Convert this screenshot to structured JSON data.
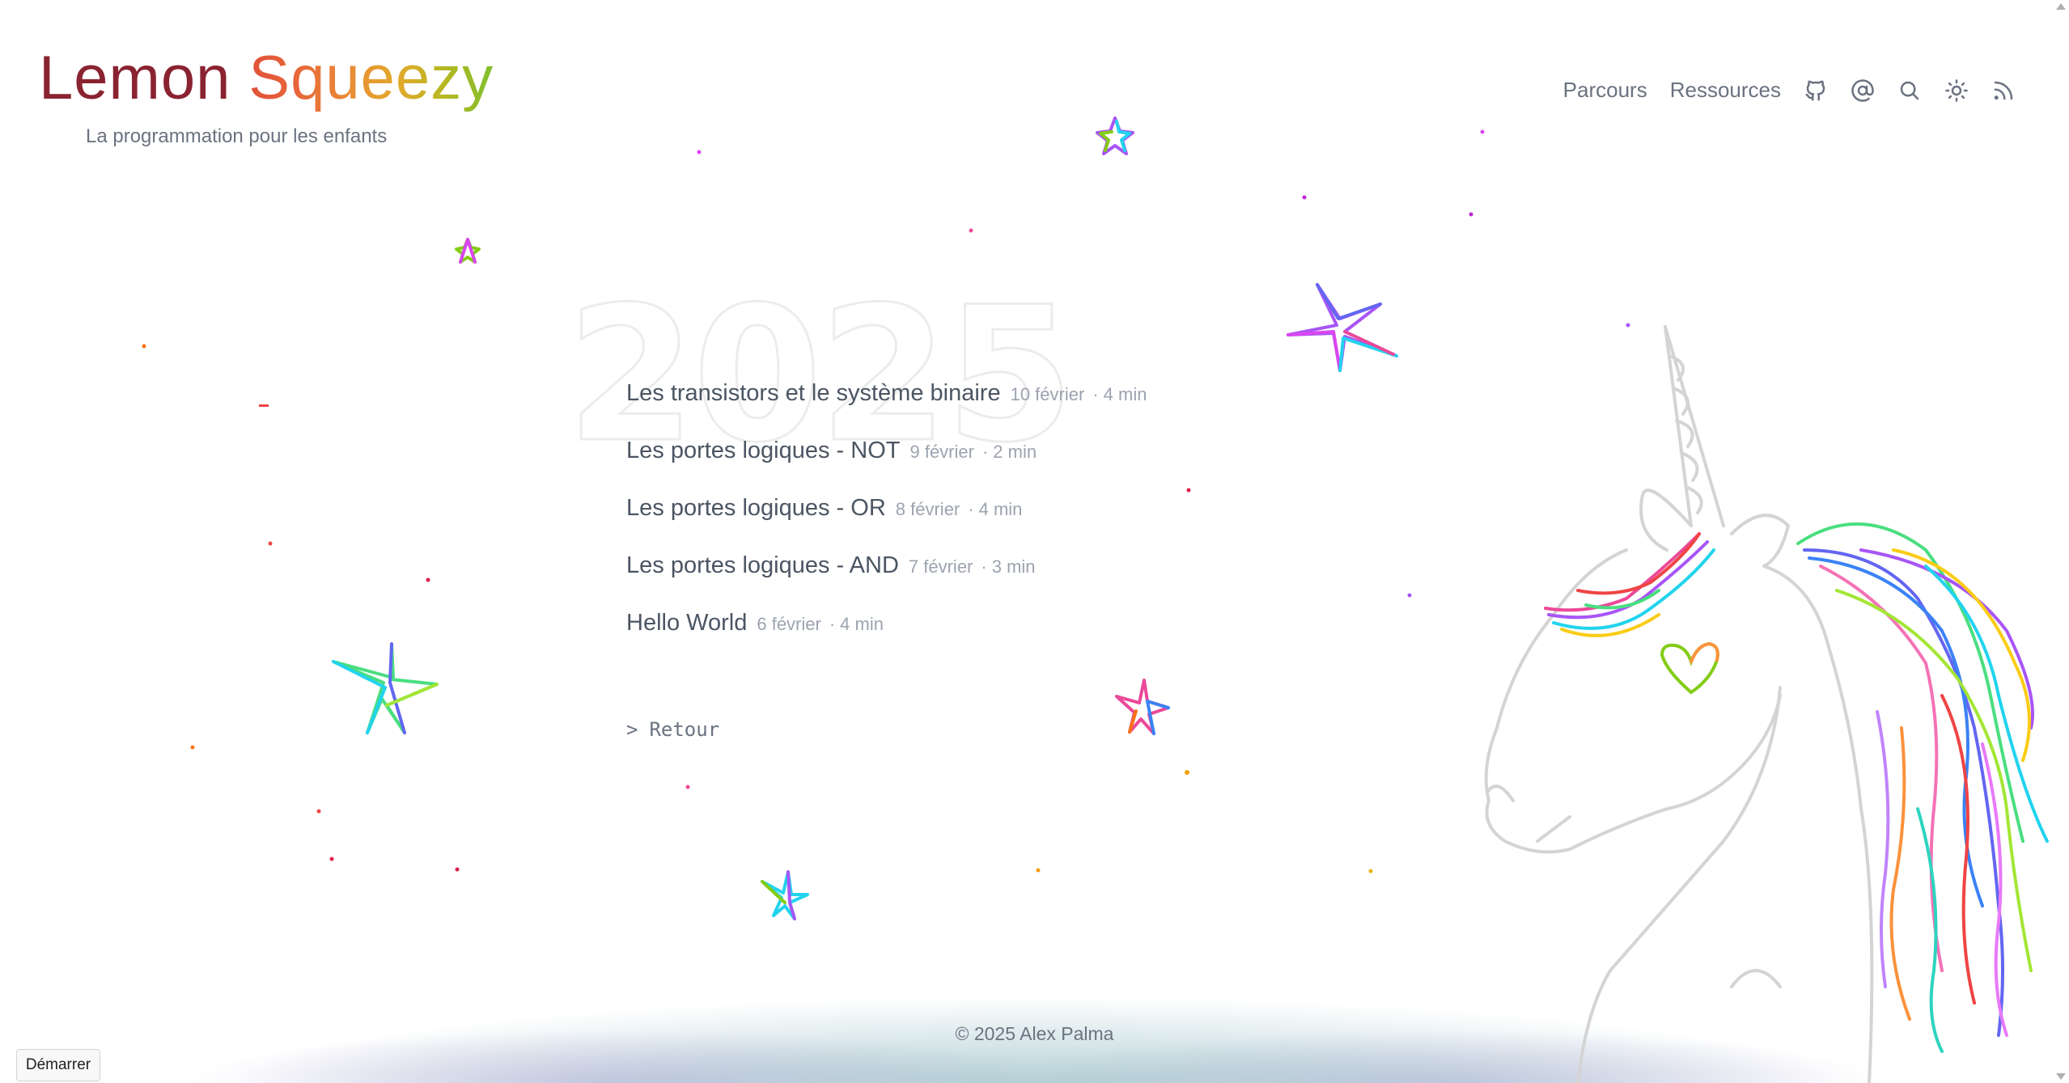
{
  "site": {
    "logo_word1": "Lemon",
    "logo_word2": "Squeezy",
    "logo_colors": [
      "#7a1f2b",
      "#7a1f2b",
      "#8a2430",
      "#9a2935",
      "#aa2e39"
    ],
    "squeezy_colors": [
      "#e0523a",
      "#e0553a",
      "#e2603a",
      "#e6783a",
      "#ea8e38",
      "#e3a52c",
      "#b8b322"
    ],
    "tagline": "La programmation pour les enfants"
  },
  "nav": {
    "links": [
      "Parcours",
      "Ressources"
    ],
    "icons": [
      "github-icon",
      "at-icon",
      "search-icon",
      "sun-icon",
      "rss-icon"
    ]
  },
  "archive": {
    "year": "2025",
    "posts": [
      {
        "title": "Les transistors et le système binaire",
        "date": "10 février",
        "duration": "4 min"
      },
      {
        "title": "Les portes logiques - NOT",
        "date": "9 février",
        "duration": "2 min"
      },
      {
        "title": "Les portes logiques - OR",
        "date": "8 février",
        "duration": "4 min"
      },
      {
        "title": "Les portes logiques - AND",
        "date": "7 février",
        "duration": "3 min"
      },
      {
        "title": "Hello World",
        "date": "6 février",
        "duration": "4 min"
      }
    ],
    "separator": "·",
    "back_label": "Retour"
  },
  "footer": {
    "copyright": "© 2025 Alex Palma"
  },
  "start_button": "Démarrer"
}
